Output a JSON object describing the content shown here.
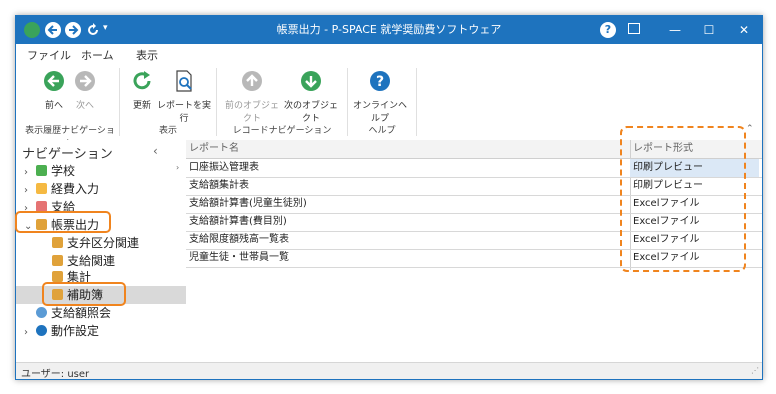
{
  "window": {
    "title": "帳票出力 - P-SPACE 就学奨励費ソフトウェア",
    "help_label": "?",
    "minimize_label": "—",
    "maximize_label": "☐",
    "close_label": "✕",
    "accent_color": "#1e73be"
  },
  "tabs": [
    {
      "label": "ファイル",
      "active": false
    },
    {
      "label": "ホーム",
      "active": true
    },
    {
      "label": "表示",
      "active": false
    }
  ],
  "ribbon": {
    "buttons": {
      "back": {
        "label": "前へ",
        "enabled": true
      },
      "forward": {
        "label": "次へ",
        "enabled": false
      },
      "refresh": {
        "label": "更新",
        "enabled": true
      },
      "run_report": {
        "label": "レポートを実行",
        "enabled": true
      },
      "prev_object": {
        "label": "前のオブジェクト",
        "enabled": false
      },
      "next_object": {
        "label": "次のオブジェクト",
        "enabled": true
      },
      "online_help": {
        "label": "オンラインヘルプ",
        "enabled": true
      }
    },
    "groups": {
      "history": "表示履歴ナビゲーション",
      "view": "表示",
      "record": "レコードナビゲーション",
      "help": "ヘルプ"
    }
  },
  "navigation": {
    "title": "ナビゲーション",
    "collapse_glyph": "‹",
    "items": [
      {
        "label": "学校",
        "icon": "school-icon"
      },
      {
        "label": "経費入力",
        "icon": "folder-icon"
      },
      {
        "label": "支給",
        "icon": "calendar-icon"
      },
      {
        "label": "帳票出力",
        "icon": "report-icon"
      },
      {
        "label": "支弁区分関連",
        "icon": "report-icon"
      },
      {
        "label": "支給関連",
        "icon": "report-icon"
      },
      {
        "label": "集計",
        "icon": "report-icon"
      },
      {
        "label": "補助簿",
        "icon": "report-icon"
      },
      {
        "label": "支給額照会",
        "icon": "search-icon"
      },
      {
        "label": "動作設定",
        "icon": "gear-icon"
      }
    ]
  },
  "grid": {
    "columns": [
      "レポート名",
      "レポート形式"
    ],
    "rows": [
      [
        "口座振込管理表",
        "印刷プレビュー"
      ],
      [
        "支給額集計表",
        "印刷プレビュー"
      ],
      [
        "支給額計算書(児童生徒別)",
        "Excelファイル"
      ],
      [
        "支給額計算書(費目別)",
        "Excelファイル"
      ],
      [
        "支給限度額残高一覧表",
        "Excelファイル"
      ],
      [
        "児童生徒・世帯員一覧",
        "Excelファイル"
      ]
    ]
  },
  "status": {
    "user_text": "ユーザー: user"
  },
  "highlight_color": "#f0841e"
}
